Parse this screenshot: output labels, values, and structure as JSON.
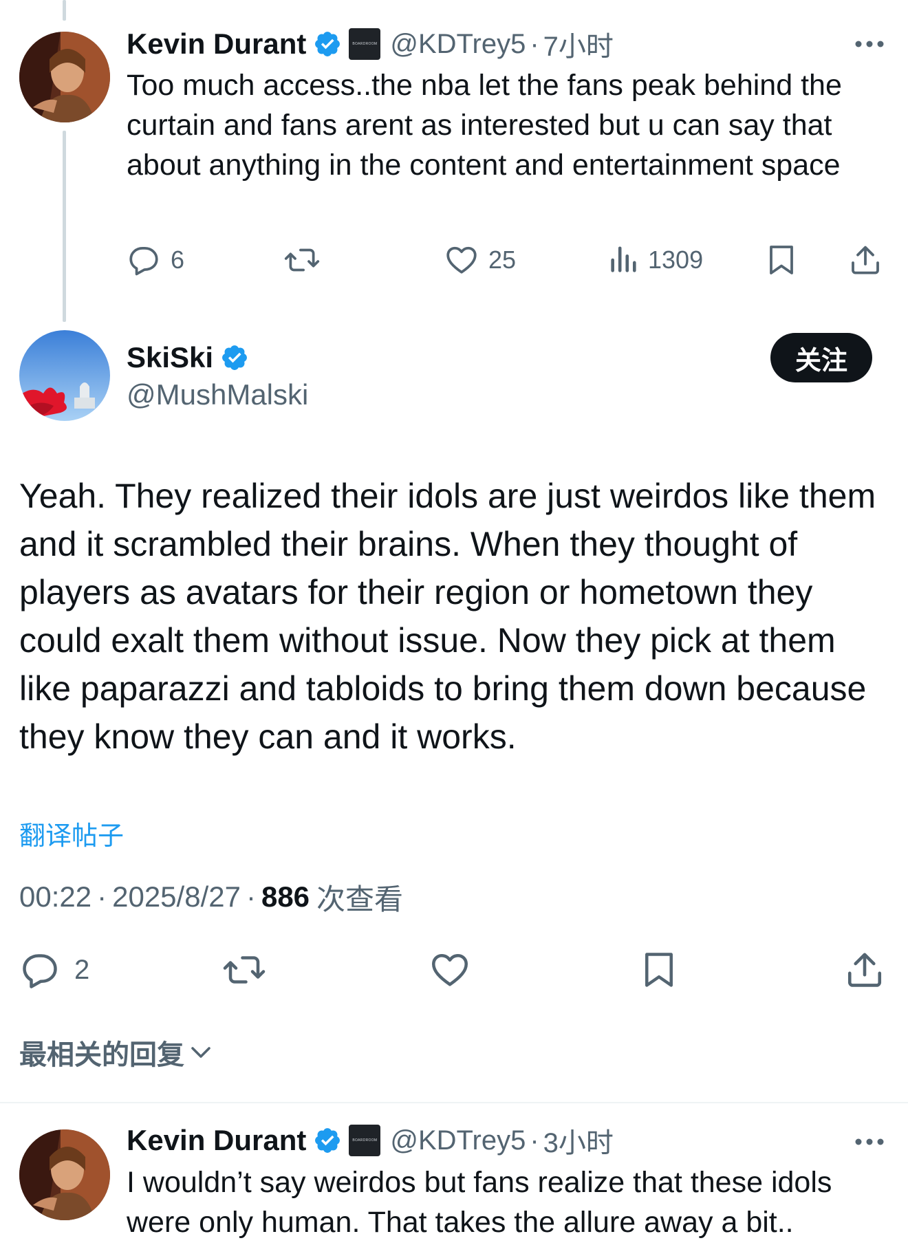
{
  "tweet_parent": {
    "author_name": "Kevin Durant",
    "handle": "@KDTrey5",
    "separator": "·",
    "time": "7小时",
    "affiliate_badge_text": "BOARDROOM",
    "text": "Too much access..the nba let the fans peak behind the curtain and fans arent as interested but u can say that about anything in the content and entertainment space",
    "reply_count": "6",
    "like_count": "25",
    "view_count": "1309"
  },
  "tweet_main": {
    "author_name": "SkiSki",
    "handle": "@MushMalski",
    "follow_label": "关注",
    "text": "Yeah. They realized their idols are just weirdos like them and it scrambled their brains. When they thought of players as avatars for their region or hometown they could exalt them without issue. Now they pick at them like paparazzi and tabloids to bring them down because they know they can and it works.",
    "translate_label": "翻译帖子",
    "time": "00:22",
    "date": "2025/8/27",
    "separator": "·",
    "views_count": "886",
    "views_label": "次查看",
    "reply_count": "2"
  },
  "replies_sort": {
    "label": "最相关的回复"
  },
  "tweet_reply": {
    "author_name": "Kevin Durant",
    "handle": "@KDTrey5",
    "separator": "·",
    "time": "3小时",
    "affiliate_badge_text": "BOARDROOM",
    "text": "I wouldn’t say weirdos but fans realize that these idols were only human. That takes the allure away a bit.."
  },
  "icons": {
    "verified": "verified-badge-icon",
    "reply": "reply-icon",
    "retweet": "retweet-icon",
    "like": "heart-icon",
    "views": "views-icon",
    "bookmark": "bookmark-icon",
    "share": "share-icon",
    "more": "more-icon",
    "chevron": "chevron-down-icon"
  },
  "colors": {
    "accent": "#1d9bf0",
    "text": "#0f1419",
    "muted": "#536471",
    "follow_bg": "#0f1419"
  }
}
